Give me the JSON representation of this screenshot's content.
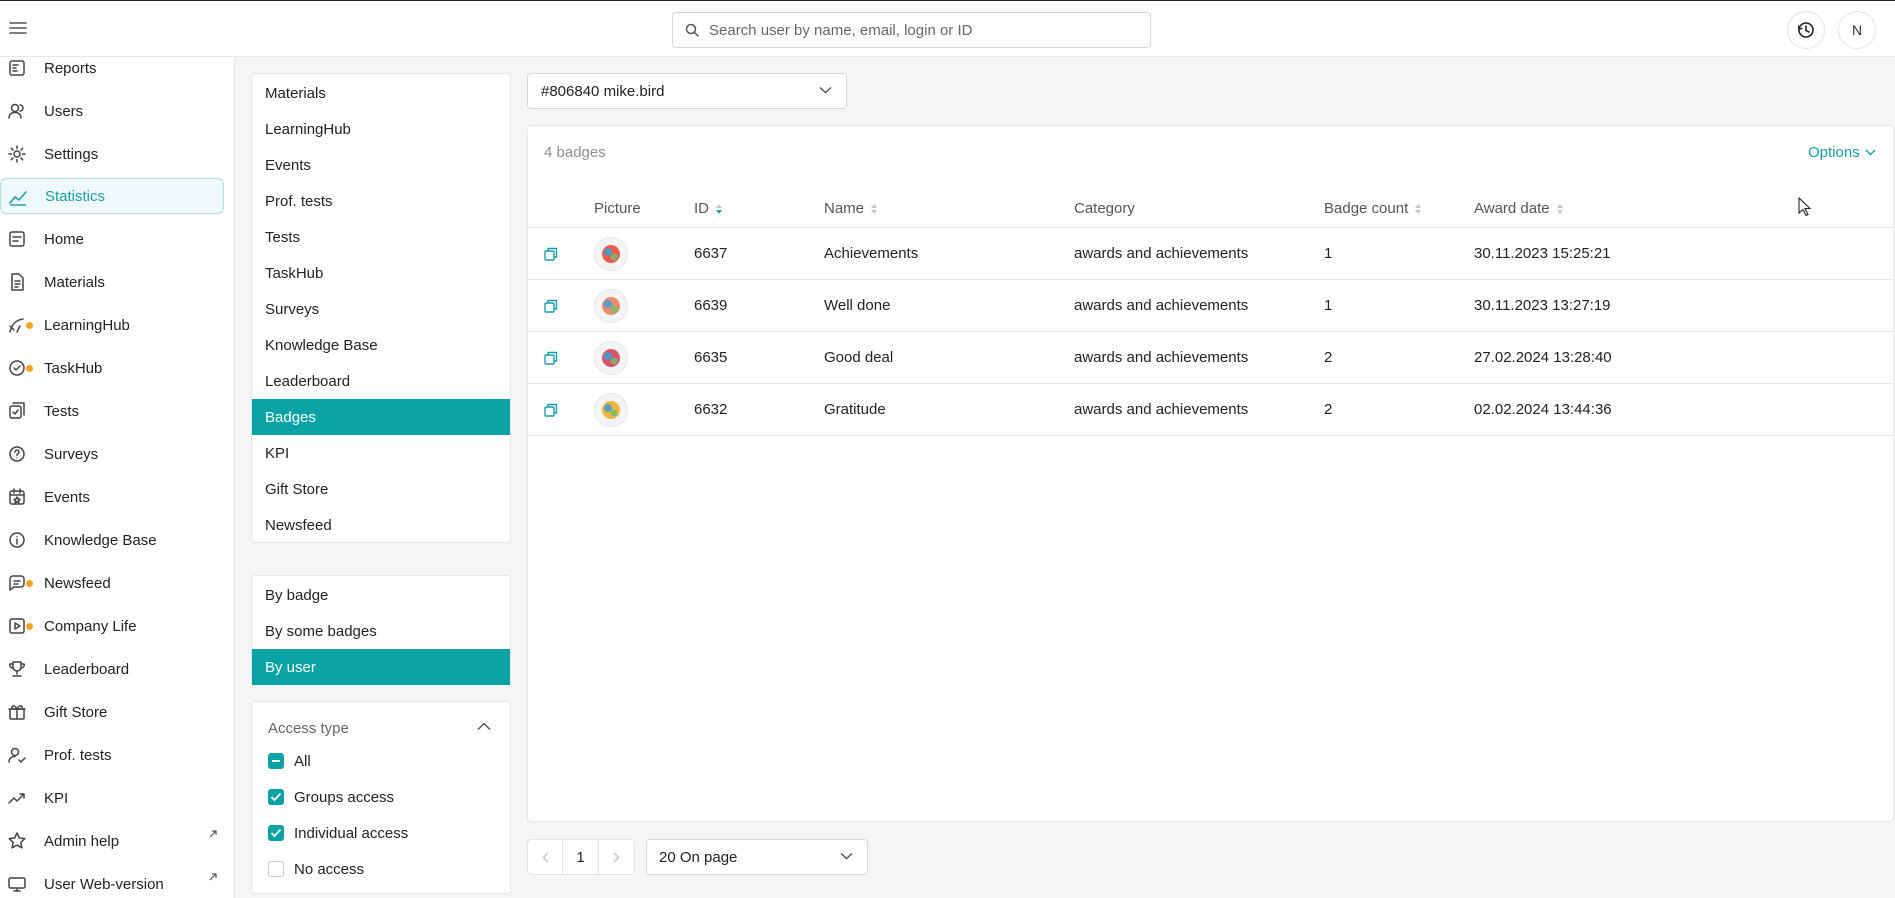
{
  "topbar": {
    "menu_icon": "hamburger-icon",
    "search_placeholder": "Search user by name, email, login or ID",
    "history_icon": "history-icon",
    "avatar_initial": "N"
  },
  "sidebar": {
    "items": [
      {
        "label": "Reports",
        "icon": "reports-icon",
        "active": false
      },
      {
        "label": "Users",
        "icon": "users-icon",
        "active": false
      },
      {
        "label": "Settings",
        "icon": "gear-icon",
        "active": false
      },
      {
        "label": "Statistics",
        "icon": "statistics-icon",
        "active": true
      },
      {
        "label": "Home",
        "icon": "home-icon",
        "active": false
      },
      {
        "label": "Materials",
        "icon": "materials-icon",
        "active": false
      },
      {
        "label": "LearningHub",
        "icon": "learninghub-icon",
        "active": false,
        "dot": true
      },
      {
        "label": "TaskHub",
        "icon": "taskhub-icon",
        "active": false,
        "dot": true
      },
      {
        "label": "Tests",
        "icon": "tests-icon",
        "active": false
      },
      {
        "label": "Surveys",
        "icon": "surveys-icon",
        "active": false
      },
      {
        "label": "Events",
        "icon": "events-icon",
        "active": false
      },
      {
        "label": "Knowledge Base",
        "icon": "info-icon",
        "active": false
      },
      {
        "label": "Newsfeed",
        "icon": "newsfeed-icon",
        "active": false,
        "dot": true
      },
      {
        "label": "Company Life",
        "icon": "company-life-icon",
        "active": false,
        "dot": true
      },
      {
        "label": "Leaderboard",
        "icon": "trophy-icon",
        "active": false
      },
      {
        "label": "Gift Store",
        "icon": "gift-icon",
        "active": false
      },
      {
        "label": "Prof. tests",
        "icon": "prof-tests-icon",
        "active": false
      },
      {
        "label": "KPI",
        "icon": "kpi-icon",
        "active": false
      },
      {
        "label": "Admin help",
        "icon": "star-icon",
        "active": false,
        "external": true
      },
      {
        "label": "User Web-version",
        "icon": "monitor-icon",
        "active": false,
        "external": true
      }
    ]
  },
  "categories": {
    "items": [
      "Materials",
      "LearningHub",
      "Events",
      "Prof. tests",
      "Tests",
      "TaskHub",
      "Surveys",
      "Knowledge Base",
      "Leaderboard",
      "Badges",
      "KPI",
      "Gift Store",
      "Newsfeed"
    ],
    "active": "Badges"
  },
  "modes": {
    "items": [
      "By badge",
      "By some badges",
      "By user"
    ],
    "active": "By user"
  },
  "access": {
    "title": "Access type",
    "options": [
      {
        "label": "All",
        "state": "indeterminate"
      },
      {
        "label": "Groups access",
        "state": "checked"
      },
      {
        "label": "Individual access",
        "state": "checked"
      },
      {
        "label": "No access",
        "state": "unchecked"
      }
    ]
  },
  "user_select": {
    "value": "#806840 mike.bird"
  },
  "table": {
    "count_label": "4 badges",
    "options_label": "Options",
    "columns": [
      "Picture",
      "ID",
      "Name",
      "Category",
      "Badge count",
      "Award date"
    ],
    "rows": [
      {
        "id": "6637",
        "name": "Achievements",
        "category": "awards and achievements",
        "count": "1",
        "date": "30.11.2023 15:25:21",
        "pic_color": "#ef5a4a"
      },
      {
        "id": "6639",
        "name": "Well done",
        "category": "awards and achievements",
        "count": "1",
        "date": "30.11.2023 13:27:19",
        "pic_color": "#e98c6b"
      },
      {
        "id": "6635",
        "name": "Good deal",
        "category": "awards and achievements",
        "count": "2",
        "date": "27.02.2024 13:28:40",
        "pic_color": "#d9546a"
      },
      {
        "id": "6632",
        "name": "Gratitude",
        "category": "awards and achievements",
        "count": "2",
        "date": "02.02.2024 13:44:36",
        "pic_color": "#f2b63c"
      }
    ]
  },
  "pagination": {
    "current_page": "1",
    "per_page_label": "20 On page"
  },
  "colors": {
    "accent": "#0aa3a5",
    "accent_text": "#1a9ea8",
    "notification_dot": "#f4a323"
  }
}
